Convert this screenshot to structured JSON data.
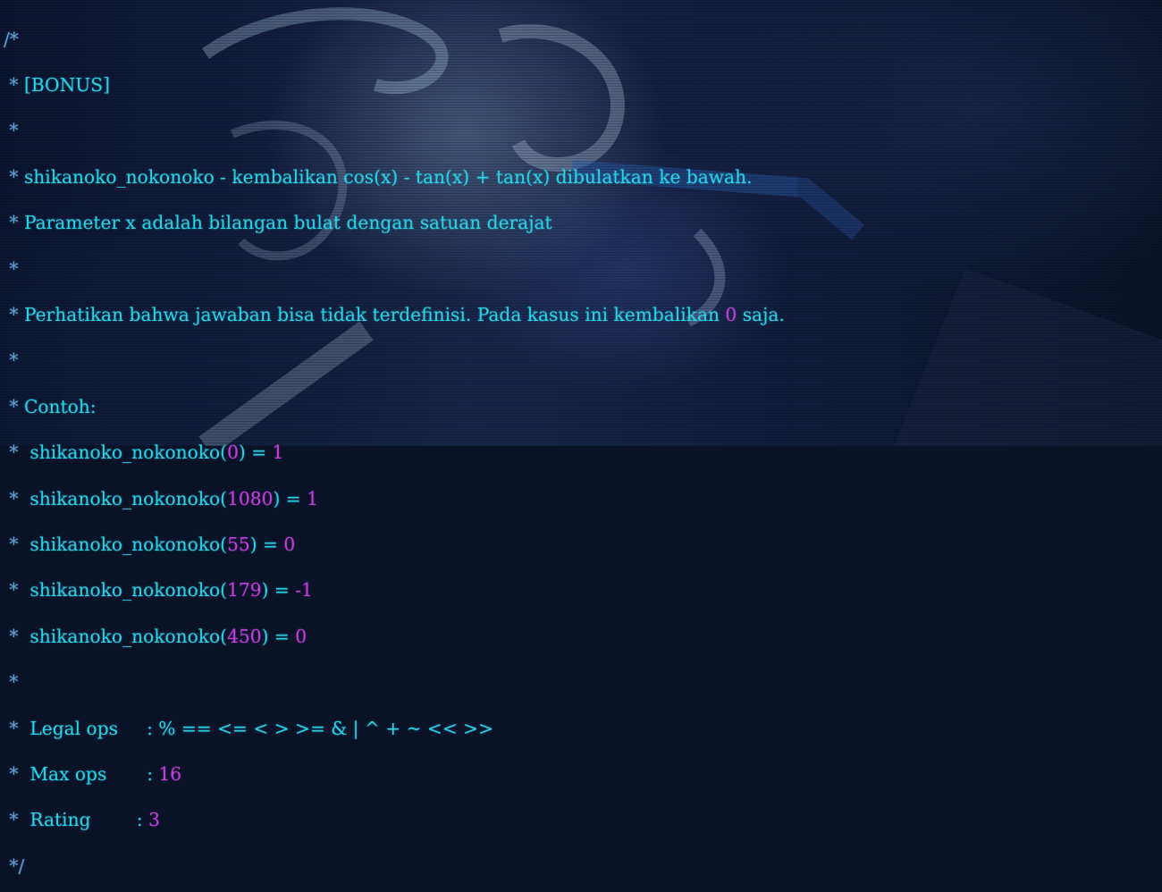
{
  "header": {
    "comment_open": "/*",
    "bonus_tag": "[BONUS]"
  },
  "description": {
    "line1": "shikanoko_nokonoko - kembalikan cos(x) - tan(x) + tan(x) dibulatkan ke bawah.",
    "line2": "Parameter x adalah bilangan bulat dengan satuan derajat",
    "note_before": "Perhatikan bahwa jawaban bisa tidak terdefinisi. Pada kasus ini kembalikan ",
    "note_value": "0",
    "note_after": " saja."
  },
  "examples": {
    "label": "Contoh:",
    "items": [
      {
        "fn": "shikanoko_nokonoko",
        "arg": "0",
        "result": "1"
      },
      {
        "fn": "shikanoko_nokonoko",
        "arg": "1080",
        "result": "1"
      },
      {
        "fn": "shikanoko_nokonoko",
        "arg": "55",
        "result": "0"
      },
      {
        "fn": "shikanoko_nokonoko",
        "arg": "179",
        "result": "-1"
      },
      {
        "fn": "shikanoko_nokonoko",
        "arg": "450",
        "result": "0"
      }
    ]
  },
  "meta": {
    "legal_ops_label": "Legal ops",
    "legal_ops_value": "% == <= < > >= & | ^ + ~ << >>",
    "max_ops_label": "Max ops",
    "max_ops_value": "16",
    "rating_label": "Rating",
    "rating_value": "3"
  },
  "footer": {
    "comment_close": "*/"
  },
  "colors": {
    "text": "#2ad2e6",
    "number": "#c040d8",
    "comment_star": "#6e9ad0",
    "background": "#0a1228"
  }
}
